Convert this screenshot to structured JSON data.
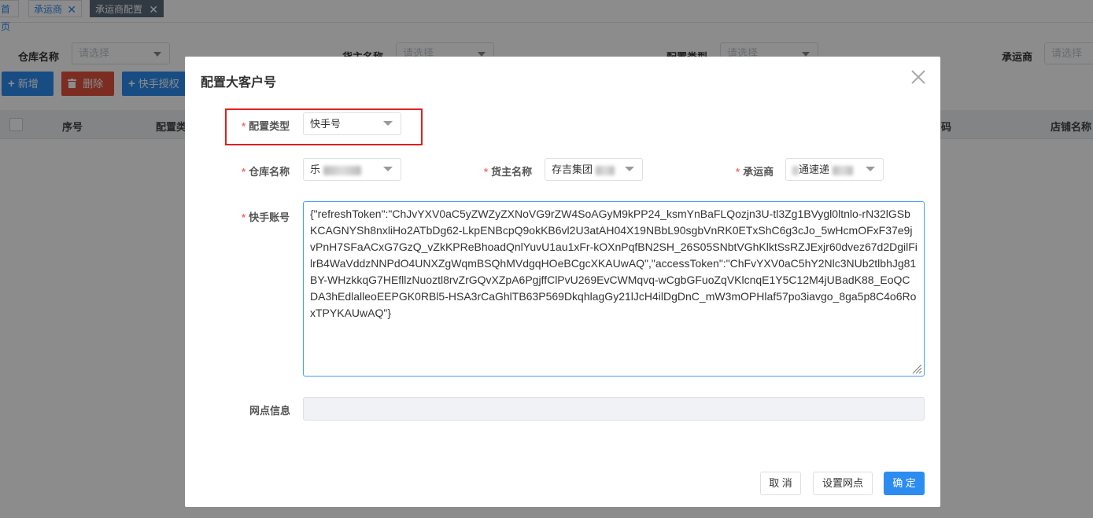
{
  "tabs": [
    {
      "label": "首页",
      "closable": false
    },
    {
      "label": "承运商",
      "closable": true
    },
    {
      "label": "承运商配置",
      "closable": true
    }
  ],
  "tab_close_glyph": "✕",
  "filters": {
    "warehouse": {
      "label": "仓库名称",
      "placeholder": "请选择"
    },
    "owner": {
      "label": "货主名称",
      "placeholder": "请选择"
    },
    "config_type": {
      "label": "配置类型",
      "placeholder": "请选择"
    },
    "carrier": {
      "label": "承运商",
      "placeholder": "请选择"
    }
  },
  "toolbar": {
    "add": "新增",
    "delete": "删除",
    "kuaishou_auth": "快手授权"
  },
  "table_headers": [
    "序号",
    "配置类型",
    "码",
    "店铺名称"
  ],
  "modal": {
    "title": "配置大客户号",
    "config_type": {
      "label": "配置类型",
      "value": "快手号"
    },
    "warehouse": {
      "label": "仓库名称",
      "value": "乐"
    },
    "owner": {
      "label": "货主名称",
      "value": "存吉集团"
    },
    "carrier": {
      "label": "承运商",
      "value": "通速递"
    },
    "kuaishou_account": {
      "label": "快手账号",
      "value": "{\"refreshToken\":\"ChJvYXV0aC5yZWZyZXNoVG9rZW4SoAGyM9kPP24_ksmYnBaFLQozjn3U-tl3Zg1BVygl0ltnlo-rN32lGSbKCAGNYSh8nxliHo2ATbDg62-LkpENBcpQ9okKB6vl2U3atAH04X19NBbL90sgbVnRK0ETxShC6g3cJo_5wHcmOFxF37e9jvPnH7SFaACxG7GzQ_vZkKPReBhoadQnlYuvU1au1xFr-kOXnPqfBN2SH_26S05SNbtVGhKlktSsRZJExjr60dvez67d2DgilFilrB4WaVddzNNPdO4UNXZgWqmBSQhMVdgqHOeBCgcXKAUwAQ\",\"accessToken\":\"ChFvYXV0aC5hY2Nlc3NUb2tlbhJg81BY-WHzkkqG7HEfllzNuoztl8rvZrGQvXZpA6PgjffClPvU269EvCWMqvq-wCgbGFuoZqVKlcnqE1Y5C12M4jUBadK88_EoQCDA3hEdlalleoEEPGK0RBl5-HSA3rCaGhlTB63P569DkqhlagGy21lJcH4ilDgDnC_mW3mOPHlaf57po3iavgo_8ga5p8C4o6RoxTPYKAUwAQ\"}"
    },
    "network_info": {
      "label": "网点信息",
      "value": ""
    },
    "buttons": {
      "cancel": "取 消",
      "set_network": "设置网点",
      "ok": "确 定"
    },
    "required_mark": "*"
  },
  "colors": {
    "primary": "#2d8cf0",
    "danger": "#e0533f",
    "highlight_box": "#e02020",
    "required": "#f56c6c"
  }
}
